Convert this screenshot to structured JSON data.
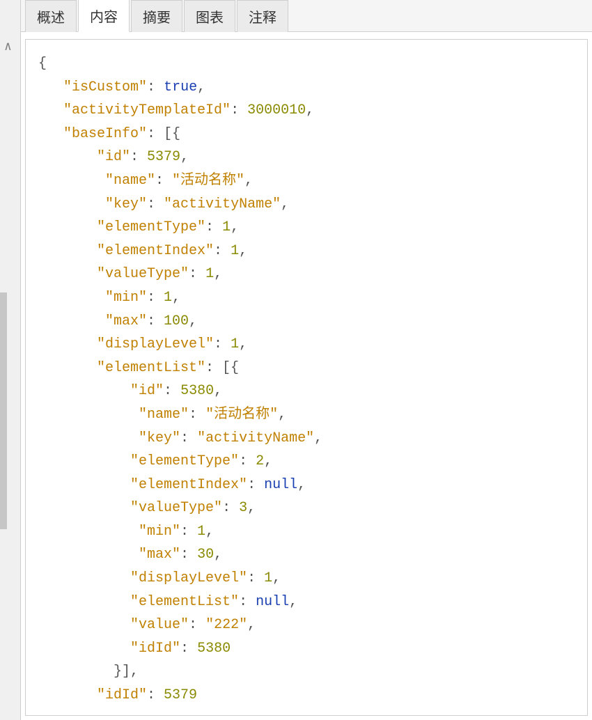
{
  "tabs": [
    {
      "label": "概述"
    },
    {
      "label": "内容"
    },
    {
      "label": "摘要"
    },
    {
      "label": "图表"
    },
    {
      "label": "注释"
    }
  ],
  "activeTab": 1,
  "scrollArrow": "∧",
  "json": {
    "isCustom": true,
    "activityTemplateId": 3000010,
    "baseInfo": [
      {
        "id": 5379,
        "name": "活动名称",
        "key": "activityName",
        "elementType": 1,
        "elementIndex": 1,
        "valueType": 1,
        "min": 1,
        "max": 100,
        "displayLevel": 1,
        "elementList": [
          {
            "id": 5380,
            "name": "活动名称",
            "key": "activityName",
            "elementType": 2,
            "elementIndex": null,
            "valueType": 3,
            "min": 1,
            "max": 30,
            "displayLevel": 1,
            "elementList": null,
            "value": "222",
            "idId": 5380
          }
        ],
        "idId": 5379
      }
    ]
  }
}
